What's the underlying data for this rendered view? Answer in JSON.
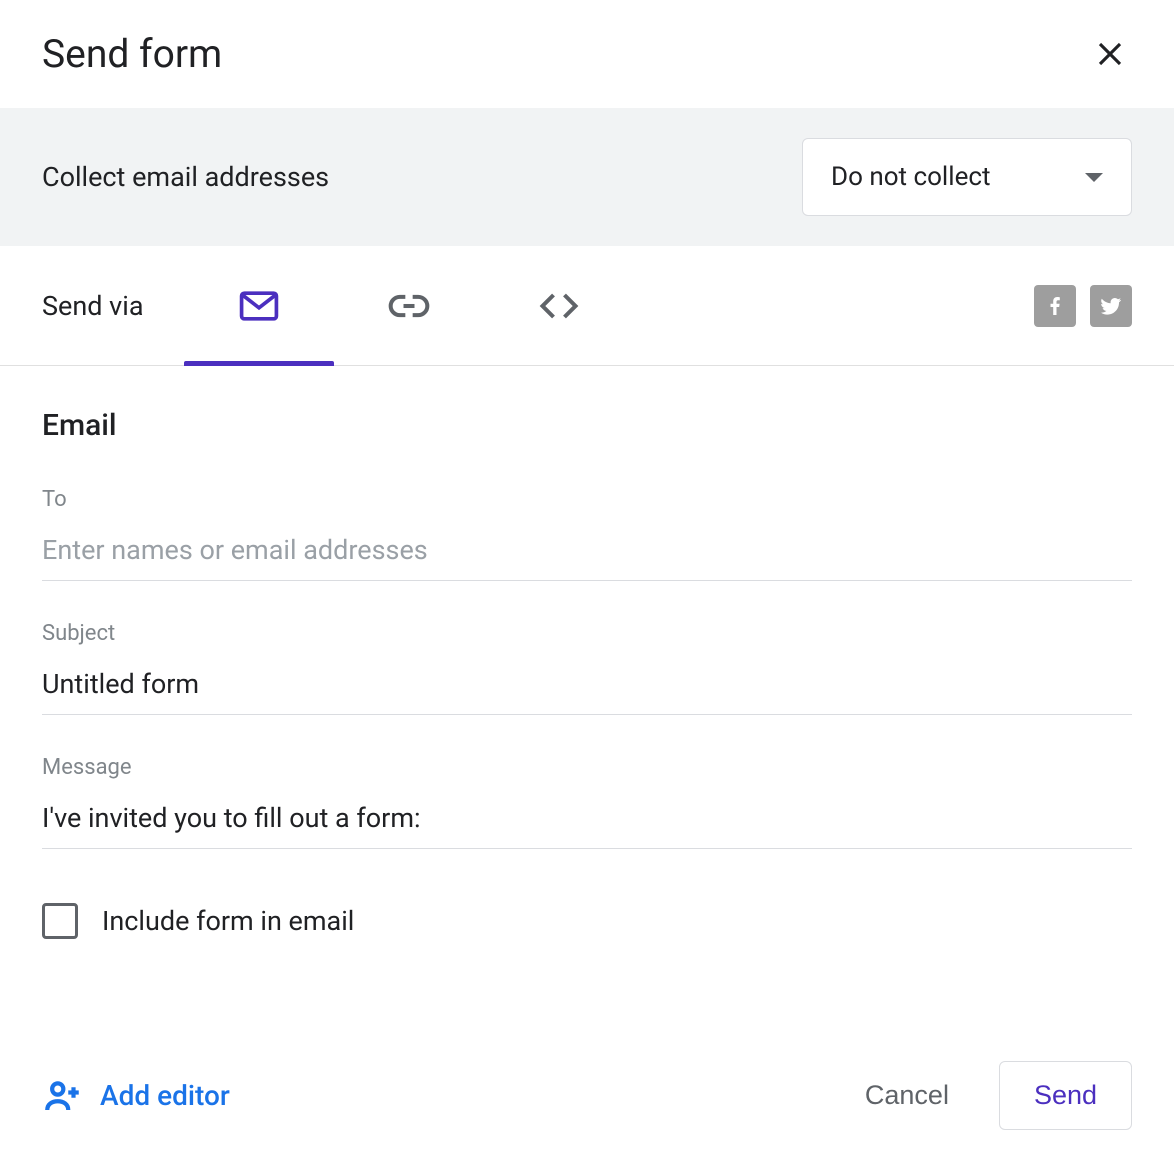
{
  "dialog": {
    "title": "Send form"
  },
  "collect": {
    "label": "Collect email addresses",
    "selected": "Do not collect"
  },
  "sendvia": {
    "label": "Send via"
  },
  "email": {
    "section_title": "Email",
    "to_label": "To",
    "to_placeholder": "Enter names or email addresses",
    "to_value": "",
    "subject_label": "Subject",
    "subject_value": "Untitled form",
    "message_label": "Message",
    "message_value": "I've invited you to fill out a form:",
    "include_label": "Include form in email",
    "include_checked": false
  },
  "footer": {
    "add_editor": "Add editor",
    "cancel": "Cancel",
    "send": "Send"
  }
}
